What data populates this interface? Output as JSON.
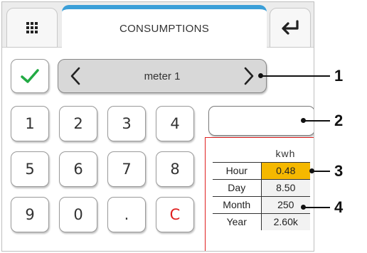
{
  "header": {
    "title": "CONSUMPTIONS",
    "left_icon": "grid-menu-icon",
    "right_icon": "enter-return-icon",
    "accent_color": "#3b9fd8"
  },
  "selector": {
    "label": "meter 1",
    "prev_icon": "chevron-left-icon",
    "next_icon": "chevron-right-icon"
  },
  "confirm": {
    "icon": "check-icon",
    "color": "#22aa44"
  },
  "keypad": {
    "keys": [
      "1",
      "2",
      "3",
      "4",
      "5",
      "6",
      "7",
      "8",
      "9",
      "0",
      ".",
      "C"
    ]
  },
  "value_field": {
    "value": ""
  },
  "table": {
    "unit_header": "kwh",
    "rows": [
      {
        "label": "Hour",
        "value": "0.48",
        "highlight": true
      },
      {
        "label": "Day",
        "value": "8.50",
        "highlight": false
      },
      {
        "label": "Month",
        "value": "250",
        "highlight": false
      },
      {
        "label": "Year",
        "value": "2.60k",
        "highlight": false
      }
    ],
    "highlight_color": "#f5b800",
    "border_color": "#e02020"
  },
  "callouts": [
    "1",
    "2",
    "3",
    "4"
  ]
}
